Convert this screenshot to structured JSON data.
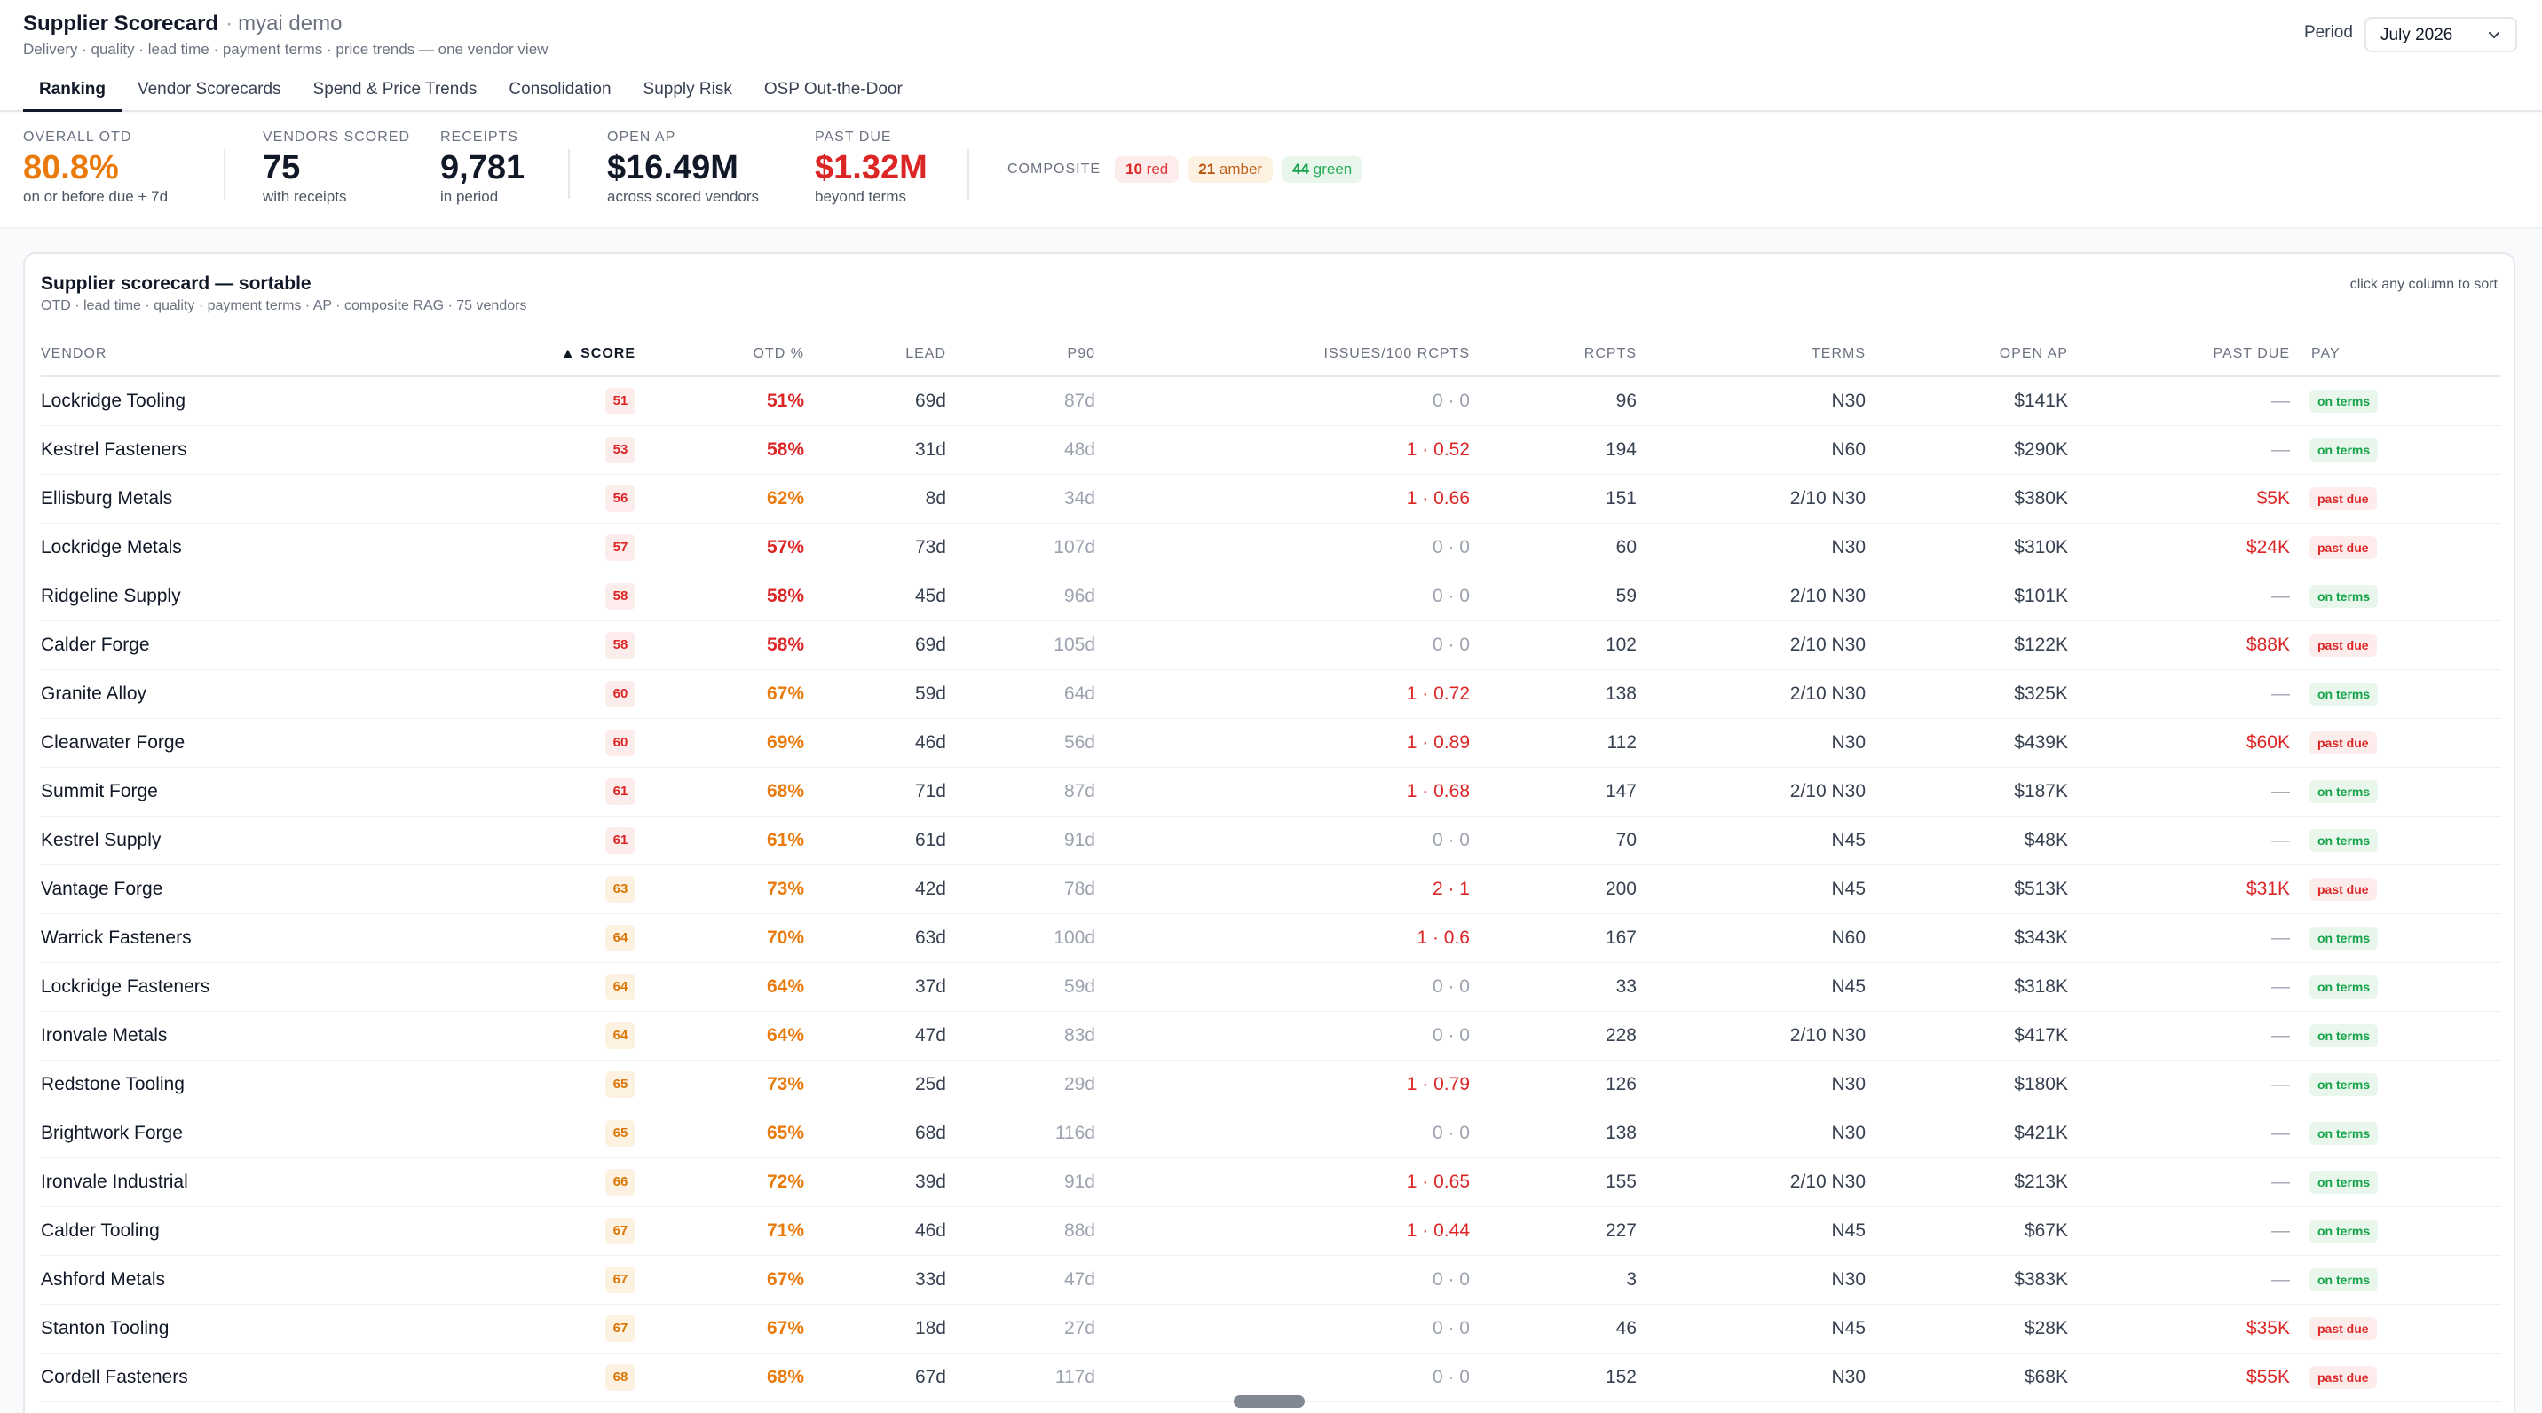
{
  "header": {
    "app_title": "Supplier Scorecard",
    "separator": "·",
    "tenant": "myai demo",
    "subtitle": "Delivery · quality · lead time · payment terms · price trends — one vendor view",
    "period_label": "Period",
    "period_value": "July 2026"
  },
  "tabs": [
    {
      "label": "Ranking",
      "active": true
    },
    {
      "label": "Vendor Scorecards"
    },
    {
      "label": "Spend & Price Trends"
    },
    {
      "label": "Consolidation"
    },
    {
      "label": "Supply Risk"
    },
    {
      "label": "OSP Out-the-Door"
    }
  ],
  "kpis": {
    "otd": {
      "label": "Overall OTD",
      "value": "80.8%",
      "sub": "on or before due + 7d"
    },
    "vendors": {
      "label": "Vendors Scored",
      "value": "75",
      "sub": "with receipts"
    },
    "receipts": {
      "label": "Receipts",
      "value": "9,781",
      "sub": "in period"
    },
    "open_ap": {
      "label": "Open AP",
      "value": "$16.49M",
      "sub": "across scored vendors"
    },
    "past_due": {
      "label": "Past Due",
      "value": "$1.32M",
      "sub": "beyond terms"
    },
    "composite": {
      "label": "COMPOSITE",
      "red": {
        "count": "10",
        "word": "red"
      },
      "amber": {
        "count": "21",
        "word": "amber"
      },
      "green": {
        "count": "44",
        "word": "green"
      }
    }
  },
  "card": {
    "title": "Supplier scorecard — sortable",
    "subtitle": "OTD · lead time · quality · payment terms · AP · composite RAG · 75 vendors",
    "hint": "click any column to sort"
  },
  "columns": {
    "vendor": "Vendor",
    "score": "▲ Score",
    "otd": "OTD %",
    "lead": "Lead",
    "p90": "P90",
    "issues": "Issues/100 Rcpts",
    "rcpts": "Rcpts",
    "terms": "Terms",
    "open_ap": "Open AP",
    "past_due": "Past Due",
    "pay": "Pay"
  },
  "rows": [
    {
      "vendor": "Lockridge Tooling",
      "score": "51",
      "score_level": "red",
      "otd": "51%",
      "otd_level": "red",
      "lead": "69d",
      "p90": "87d",
      "issues": "0 · 0",
      "issues_flag": false,
      "rcpts": "96",
      "terms": "N30",
      "open_ap": "$141K",
      "past_due": "—",
      "pay": "on terms",
      "pay_status": "ok"
    },
    {
      "vendor": "Kestrel Fasteners",
      "score": "53",
      "score_level": "red",
      "otd": "58%",
      "otd_level": "red",
      "lead": "31d",
      "p90": "48d",
      "issues": "1 · 0.52",
      "issues_flag": true,
      "rcpts": "194",
      "terms": "N60",
      "open_ap": "$290K",
      "past_due": "—",
      "pay": "on terms",
      "pay_status": "ok"
    },
    {
      "vendor": "Ellisburg Metals",
      "score": "56",
      "score_level": "red",
      "otd": "62%",
      "otd_level": "orange",
      "lead": "8d",
      "p90": "34d",
      "issues": "1 · 0.66",
      "issues_flag": true,
      "rcpts": "151",
      "terms": "2/10 N30",
      "open_ap": "$380K",
      "past_due": "$5K",
      "pay": "past due",
      "pay_status": "due"
    },
    {
      "vendor": "Lockridge Metals",
      "score": "57",
      "score_level": "red",
      "otd": "57%",
      "otd_level": "red",
      "lead": "73d",
      "p90": "107d",
      "issues": "0 · 0",
      "issues_flag": false,
      "rcpts": "60",
      "terms": "N30",
      "open_ap": "$310K",
      "past_due": "$24K",
      "pay": "past due",
      "pay_status": "due"
    },
    {
      "vendor": "Ridgeline Supply",
      "score": "58",
      "score_level": "red",
      "otd": "58%",
      "otd_level": "red",
      "lead": "45d",
      "p90": "96d",
      "issues": "0 · 0",
      "issues_flag": false,
      "rcpts": "59",
      "terms": "2/10 N30",
      "open_ap": "$101K",
      "past_due": "—",
      "pay": "on terms",
      "pay_status": "ok"
    },
    {
      "vendor": "Calder Forge",
      "score": "58",
      "score_level": "red",
      "otd": "58%",
      "otd_level": "red",
      "lead": "69d",
      "p90": "105d",
      "issues": "0 · 0",
      "issues_flag": false,
      "rcpts": "102",
      "terms": "2/10 N30",
      "open_ap": "$122K",
      "past_due": "$88K",
      "pay": "past due",
      "pay_status": "due"
    },
    {
      "vendor": "Granite Alloy",
      "score": "60",
      "score_level": "red",
      "otd": "67%",
      "otd_level": "orange",
      "lead": "59d",
      "p90": "64d",
      "issues": "1 · 0.72",
      "issues_flag": true,
      "rcpts": "138",
      "terms": "2/10 N30",
      "open_ap": "$325K",
      "past_due": "—",
      "pay": "on terms",
      "pay_status": "ok"
    },
    {
      "vendor": "Clearwater Forge",
      "score": "60",
      "score_level": "red",
      "otd": "69%",
      "otd_level": "orange",
      "lead": "46d",
      "p90": "56d",
      "issues": "1 · 0.89",
      "issues_flag": true,
      "rcpts": "112",
      "terms": "N30",
      "open_ap": "$439K",
      "past_due": "$60K",
      "pay": "past due",
      "pay_status": "due"
    },
    {
      "vendor": "Summit Forge",
      "score": "61",
      "score_level": "red",
      "otd": "68%",
      "otd_level": "orange",
      "lead": "71d",
      "p90": "87d",
      "issues": "1 · 0.68",
      "issues_flag": true,
      "rcpts": "147",
      "terms": "2/10 N30",
      "open_ap": "$187K",
      "past_due": "—",
      "pay": "on terms",
      "pay_status": "ok"
    },
    {
      "vendor": "Kestrel Supply",
      "score": "61",
      "score_level": "red",
      "otd": "61%",
      "otd_level": "orange",
      "lead": "61d",
      "p90": "91d",
      "issues": "0 · 0",
      "issues_flag": false,
      "rcpts": "70",
      "terms": "N45",
      "open_ap": "$48K",
      "past_due": "—",
      "pay": "on terms",
      "pay_status": "ok"
    },
    {
      "vendor": "Vantage Forge",
      "score": "63",
      "score_level": "amber",
      "otd": "73%",
      "otd_level": "orange",
      "lead": "42d",
      "p90": "78d",
      "issues": "2 · 1",
      "issues_flag": true,
      "rcpts": "200",
      "terms": "N45",
      "open_ap": "$513K",
      "past_due": "$31K",
      "pay": "past due",
      "pay_status": "due"
    },
    {
      "vendor": "Warrick Fasteners",
      "score": "64",
      "score_level": "amber",
      "otd": "70%",
      "otd_level": "orange",
      "lead": "63d",
      "p90": "100d",
      "issues": "1 · 0.6",
      "issues_flag": true,
      "rcpts": "167",
      "terms": "N60",
      "open_ap": "$343K",
      "past_due": "—",
      "pay": "on terms",
      "pay_status": "ok"
    },
    {
      "vendor": "Lockridge Fasteners",
      "score": "64",
      "score_level": "amber",
      "otd": "64%",
      "otd_level": "orange",
      "lead": "37d",
      "p90": "59d",
      "issues": "0 · 0",
      "issues_flag": false,
      "rcpts": "33",
      "terms": "N45",
      "open_ap": "$318K",
      "past_due": "—",
      "pay": "on terms",
      "pay_status": "ok"
    },
    {
      "vendor": "Ironvale Metals",
      "score": "64",
      "score_level": "amber",
      "otd": "64%",
      "otd_level": "orange",
      "lead": "47d",
      "p90": "83d",
      "issues": "0 · 0",
      "issues_flag": false,
      "rcpts": "228",
      "terms": "2/10 N30",
      "open_ap": "$417K",
      "past_due": "—",
      "pay": "on terms",
      "pay_status": "ok"
    },
    {
      "vendor": "Redstone Tooling",
      "score": "65",
      "score_level": "amber",
      "otd": "73%",
      "otd_level": "orange",
      "lead": "25d",
      "p90": "29d",
      "issues": "1 · 0.79",
      "issues_flag": true,
      "rcpts": "126",
      "terms": "N30",
      "open_ap": "$180K",
      "past_due": "—",
      "pay": "on terms",
      "pay_status": "ok"
    },
    {
      "vendor": "Brightwork Forge",
      "score": "65",
      "score_level": "amber",
      "otd": "65%",
      "otd_level": "orange",
      "lead": "68d",
      "p90": "116d",
      "issues": "0 · 0",
      "issues_flag": false,
      "rcpts": "138",
      "terms": "N30",
      "open_ap": "$421K",
      "past_due": "—",
      "pay": "on terms",
      "pay_status": "ok"
    },
    {
      "vendor": "Ironvale Industrial",
      "score": "66",
      "score_level": "amber",
      "otd": "72%",
      "otd_level": "orange",
      "lead": "39d",
      "p90": "91d",
      "issues": "1 · 0.65",
      "issues_flag": true,
      "rcpts": "155",
      "terms": "2/10 N30",
      "open_ap": "$213K",
      "past_due": "—",
      "pay": "on terms",
      "pay_status": "ok"
    },
    {
      "vendor": "Calder Tooling",
      "score": "67",
      "score_level": "amber",
      "otd": "71%",
      "otd_level": "orange",
      "lead": "46d",
      "p90": "88d",
      "issues": "1 · 0.44",
      "issues_flag": true,
      "rcpts": "227",
      "terms": "N45",
      "open_ap": "$67K",
      "past_due": "—",
      "pay": "on terms",
      "pay_status": "ok"
    },
    {
      "vendor": "Ashford Metals",
      "score": "67",
      "score_level": "amber",
      "otd": "67%",
      "otd_level": "orange",
      "lead": "33d",
      "p90": "47d",
      "issues": "0 · 0",
      "issues_flag": false,
      "rcpts": "3",
      "terms": "N30",
      "open_ap": "$383K",
      "past_due": "—",
      "pay": "on terms",
      "pay_status": "ok"
    },
    {
      "vendor": "Stanton Tooling",
      "score": "67",
      "score_level": "amber",
      "otd": "67%",
      "otd_level": "orange",
      "lead": "18d",
      "p90": "27d",
      "issues": "0 · 0",
      "issues_flag": false,
      "rcpts": "46",
      "terms": "N45",
      "open_ap": "$28K",
      "past_due": "$35K",
      "pay": "past due",
      "pay_status": "due"
    },
    {
      "vendor": "Cordell Fasteners",
      "score": "68",
      "score_level": "amber",
      "otd": "68%",
      "otd_level": "orange",
      "lead": "67d",
      "p90": "117d",
      "issues": "0 · 0",
      "issues_flag": false,
      "rcpts": "152",
      "terms": "N30",
      "open_ap": "$68K",
      "past_due": "$55K",
      "pay": "past due",
      "pay_status": "due"
    }
  ],
  "colors": {
    "red": "#dc2626",
    "orange": "#ea7a0c",
    "green": "#16a34a",
    "text": "#111827",
    "muted": "#6b7280"
  }
}
